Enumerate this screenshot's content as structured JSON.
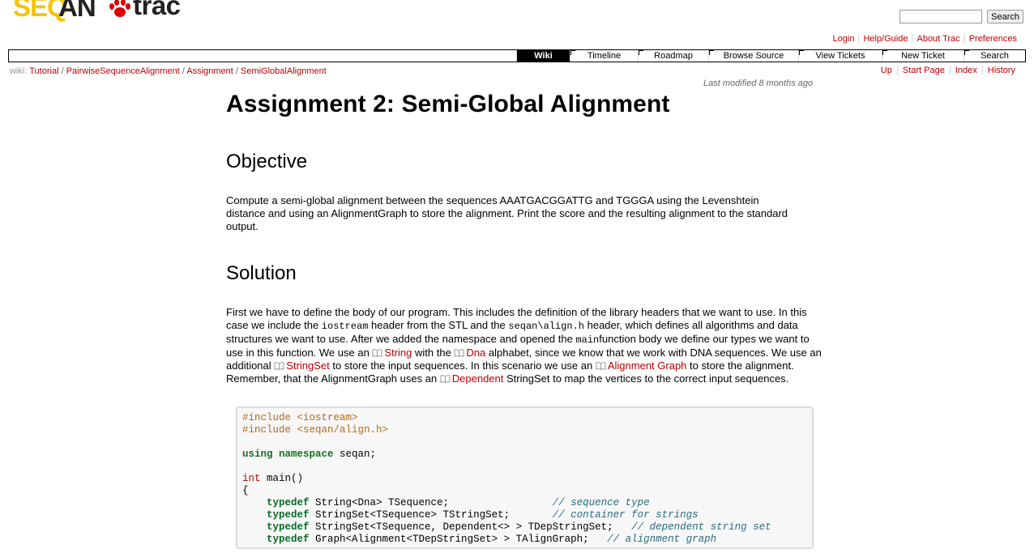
{
  "logo": {
    "seq": "SEQ",
    "an": "AN",
    "trac": "trac"
  },
  "search": {
    "placeholder": "",
    "button_label": "Search"
  },
  "metanav": [
    "Login",
    "Help/Guide",
    "About Trac",
    "Preferences"
  ],
  "mainnav": {
    "wiki": "Wiki",
    "timeline": "Timeline",
    "roadmap": "Roadmap",
    "browse_source": "Browse Source",
    "view_tickets": "View Tickets",
    "new_ticket": "New Ticket",
    "search": "Search"
  },
  "breadcrumb": {
    "label": "wiki:",
    "items": [
      "Tutorial",
      "PairwiseSequenceAlignment",
      "Assignment",
      "SemiGlobalAlignment"
    ]
  },
  "ctxtnav": [
    "Up",
    "Start Page",
    "Index",
    "History"
  ],
  "last_modified": "Last modified 8 months ago",
  "page": {
    "title": "Assignment 2: Semi-Global Alignment",
    "objective_heading": "Objective",
    "objective_text": "Compute a semi-global alignment between the sequences AAATGACGGATTG and TGGGA using the Levenshtein distance and using an AlignmentGraph to store the alignment. Print the score and the resulting alignment to the standard output.",
    "solution_heading": "Solution",
    "solution": {
      "t1": "First we have to define the body of our program. This includes the definition of the library headers that we want to use. In this case we include the ",
      "c1": "iostream",
      "t2": " header from the STL and the ",
      "c2": "seqan\\align.h",
      "t3": " header, which defines all algorithms and data structures we want to use. After we added the namespace and opened the ",
      "c3": "main",
      "t4": "function body we define our types we want to use in this function. We use an ",
      "link_string": "String",
      "t5": " with the ",
      "link_dna": "Dna",
      "t6": " alphabet, since we know that we work with DNA sequences. We use an additional ",
      "link_stringset": "StringSet",
      "t7": " to store the input sequences. In this scenario we use an ",
      "link_alignment_graph": "Alignment Graph",
      "t8": " to store the alignment. Remember, that the AlignmentGraph uses an ",
      "link_dependent": "Dependent",
      "t9": " StringSet to map the vertices to the correct input sequences."
    }
  },
  "code": {
    "l1": "#include <iostream>",
    "l2": "#include <seqan/align.h>",
    "l4_kw": "using namespace",
    "l4_rest": " seqan;",
    "l6_ty": "int",
    "l6_rest": " main()",
    "l7": "{",
    "l8_kw": "typedef",
    "l8_rest": " String<Dna> TSequence;                 ",
    "l8_cm": "// sequence type",
    "l9_kw": "typedef",
    "l9_rest": " StringSet<TSequence> TStringSet;       ",
    "l9_cm": "// container for strings",
    "l10_kw": "typedef",
    "l10_rest": " StringSet<TSequence, Dependent<> > TDepStringSet;   ",
    "l10_cm": "// dependent string set",
    "l11_kw": "typedef",
    "l11_rest": " Graph<Alignment<TDepStringSet> > TAlignGraph;   ",
    "l11_cm": "// alignment graph"
  },
  "colors": {
    "link": "#bb0000",
    "preprocessor": "#b06b1c",
    "keyword": "#12711b",
    "comment": "#2b6c7e"
  }
}
